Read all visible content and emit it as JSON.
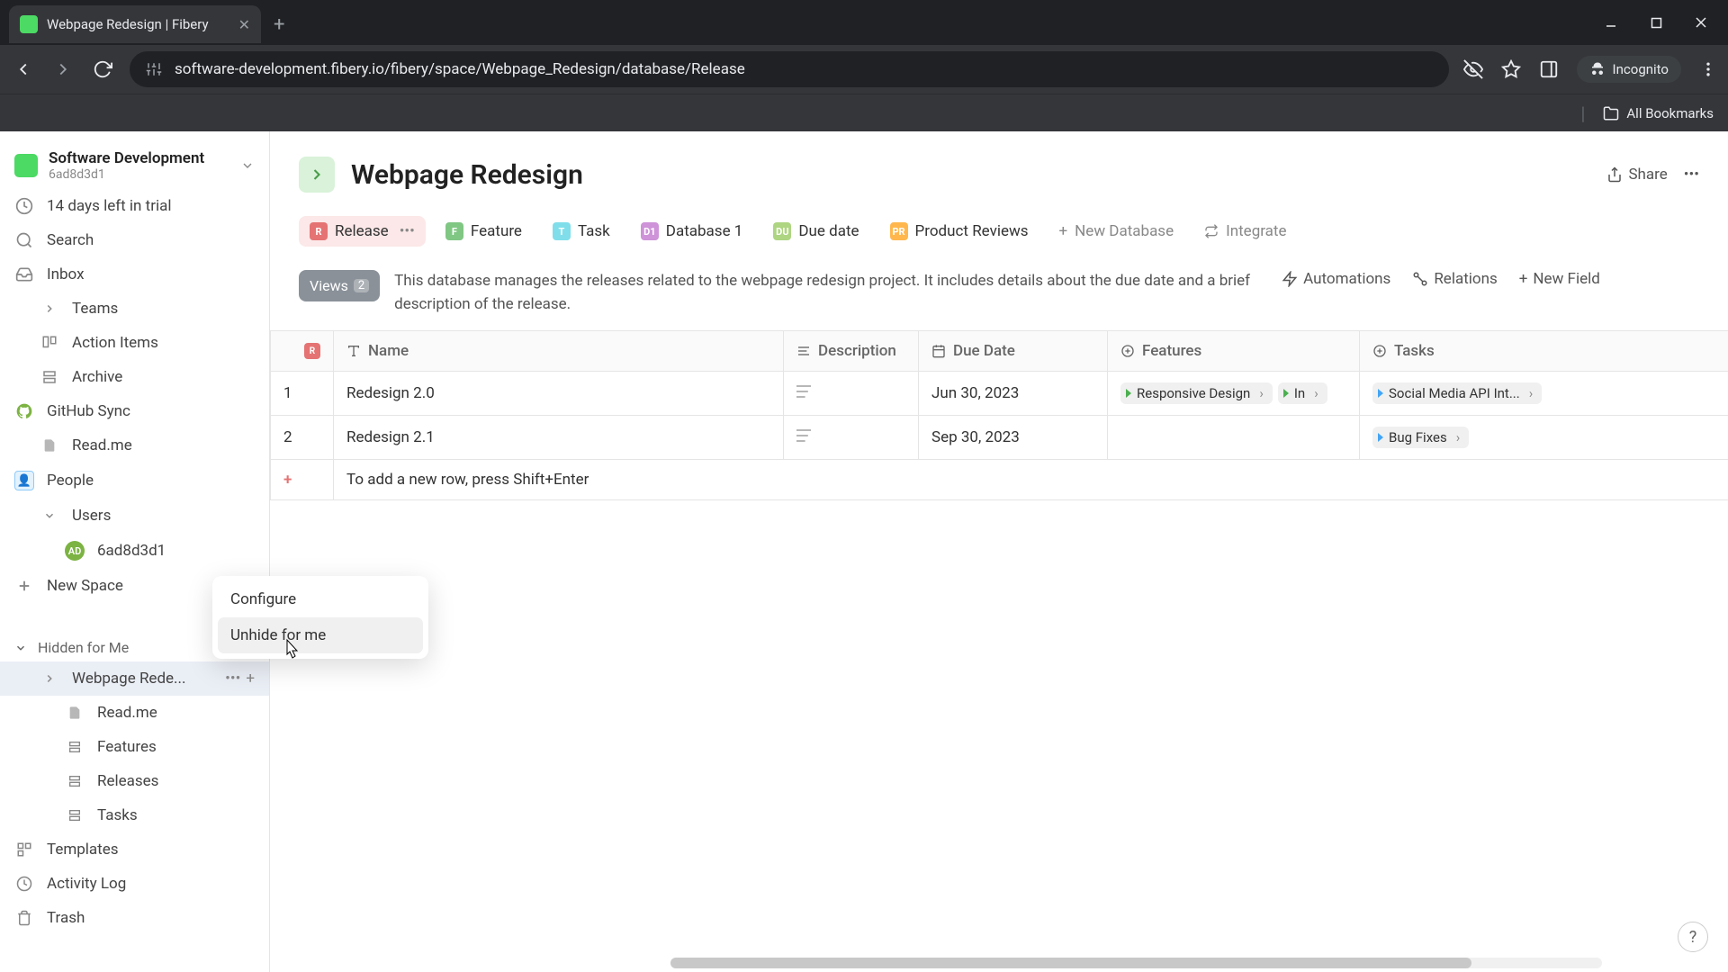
{
  "browser": {
    "tab_title": "Webpage Redesign | Fibery",
    "url": "software-development.fibery.io/fibery/space/Webpage_Redesign/database/Release",
    "incognito": "Incognito",
    "all_bookmarks": "All Bookmarks"
  },
  "workspace": {
    "name": "Software Development",
    "id": "6ad8d3d1",
    "trial": "14 days left in trial"
  },
  "sidebar": {
    "search": "Search",
    "inbox": "Inbox",
    "teams": "Teams",
    "action_items": "Action Items",
    "archive": "Archive",
    "github_sync": "GitHub Sync",
    "readme": "Read.me",
    "people": "People",
    "users": "Users",
    "user_id": "6ad8d3d1",
    "new_space": "New Space",
    "hidden_for_me": "Hidden for Me",
    "webpage_redesign": "Webpage Rede...",
    "wr_readme": "Read.me",
    "wr_features": "Features",
    "wr_releases": "Releases",
    "wr_tasks": "Tasks",
    "templates": "Templates",
    "activity_log": "Activity Log",
    "trash": "Trash"
  },
  "page": {
    "title": "Webpage Redesign",
    "share": "Share",
    "description": "This database manages the releases related to the webpage redesign project. It includes details about the due date and a brief description of the release.",
    "views_label": "Views",
    "views_count": "2",
    "automations": "Automations",
    "relations": "Relations",
    "new_field": "New Field"
  },
  "db_tabs": {
    "release": "Release",
    "feature": "Feature",
    "task": "Task",
    "database1": "Database 1",
    "due_date": "Due date",
    "product_reviews": "Product Reviews",
    "new_database": "New Database",
    "integrate": "Integrate"
  },
  "columns": {
    "name": "Name",
    "description": "Description",
    "due_date": "Due Date",
    "features": "Features",
    "tasks": "Tasks"
  },
  "rows": [
    {
      "num": "1",
      "name": "Redesign 2.0",
      "due_date": "Jun 30, 2023",
      "features": [
        {
          "label": "Responsive Design"
        },
        {
          "label": "In"
        }
      ],
      "tasks": [
        {
          "label": "Social Media API Int..."
        }
      ]
    },
    {
      "num": "2",
      "name": "Redesign 2.1",
      "due_date": "Sep 30, 2023",
      "features": [],
      "tasks": [
        {
          "label": "Bug Fixes"
        }
      ]
    }
  ],
  "add_row_hint": "To add a new row, press Shift+Enter",
  "context_menu": {
    "configure": "Configure",
    "unhide": "Unhide for me"
  },
  "help": "?"
}
